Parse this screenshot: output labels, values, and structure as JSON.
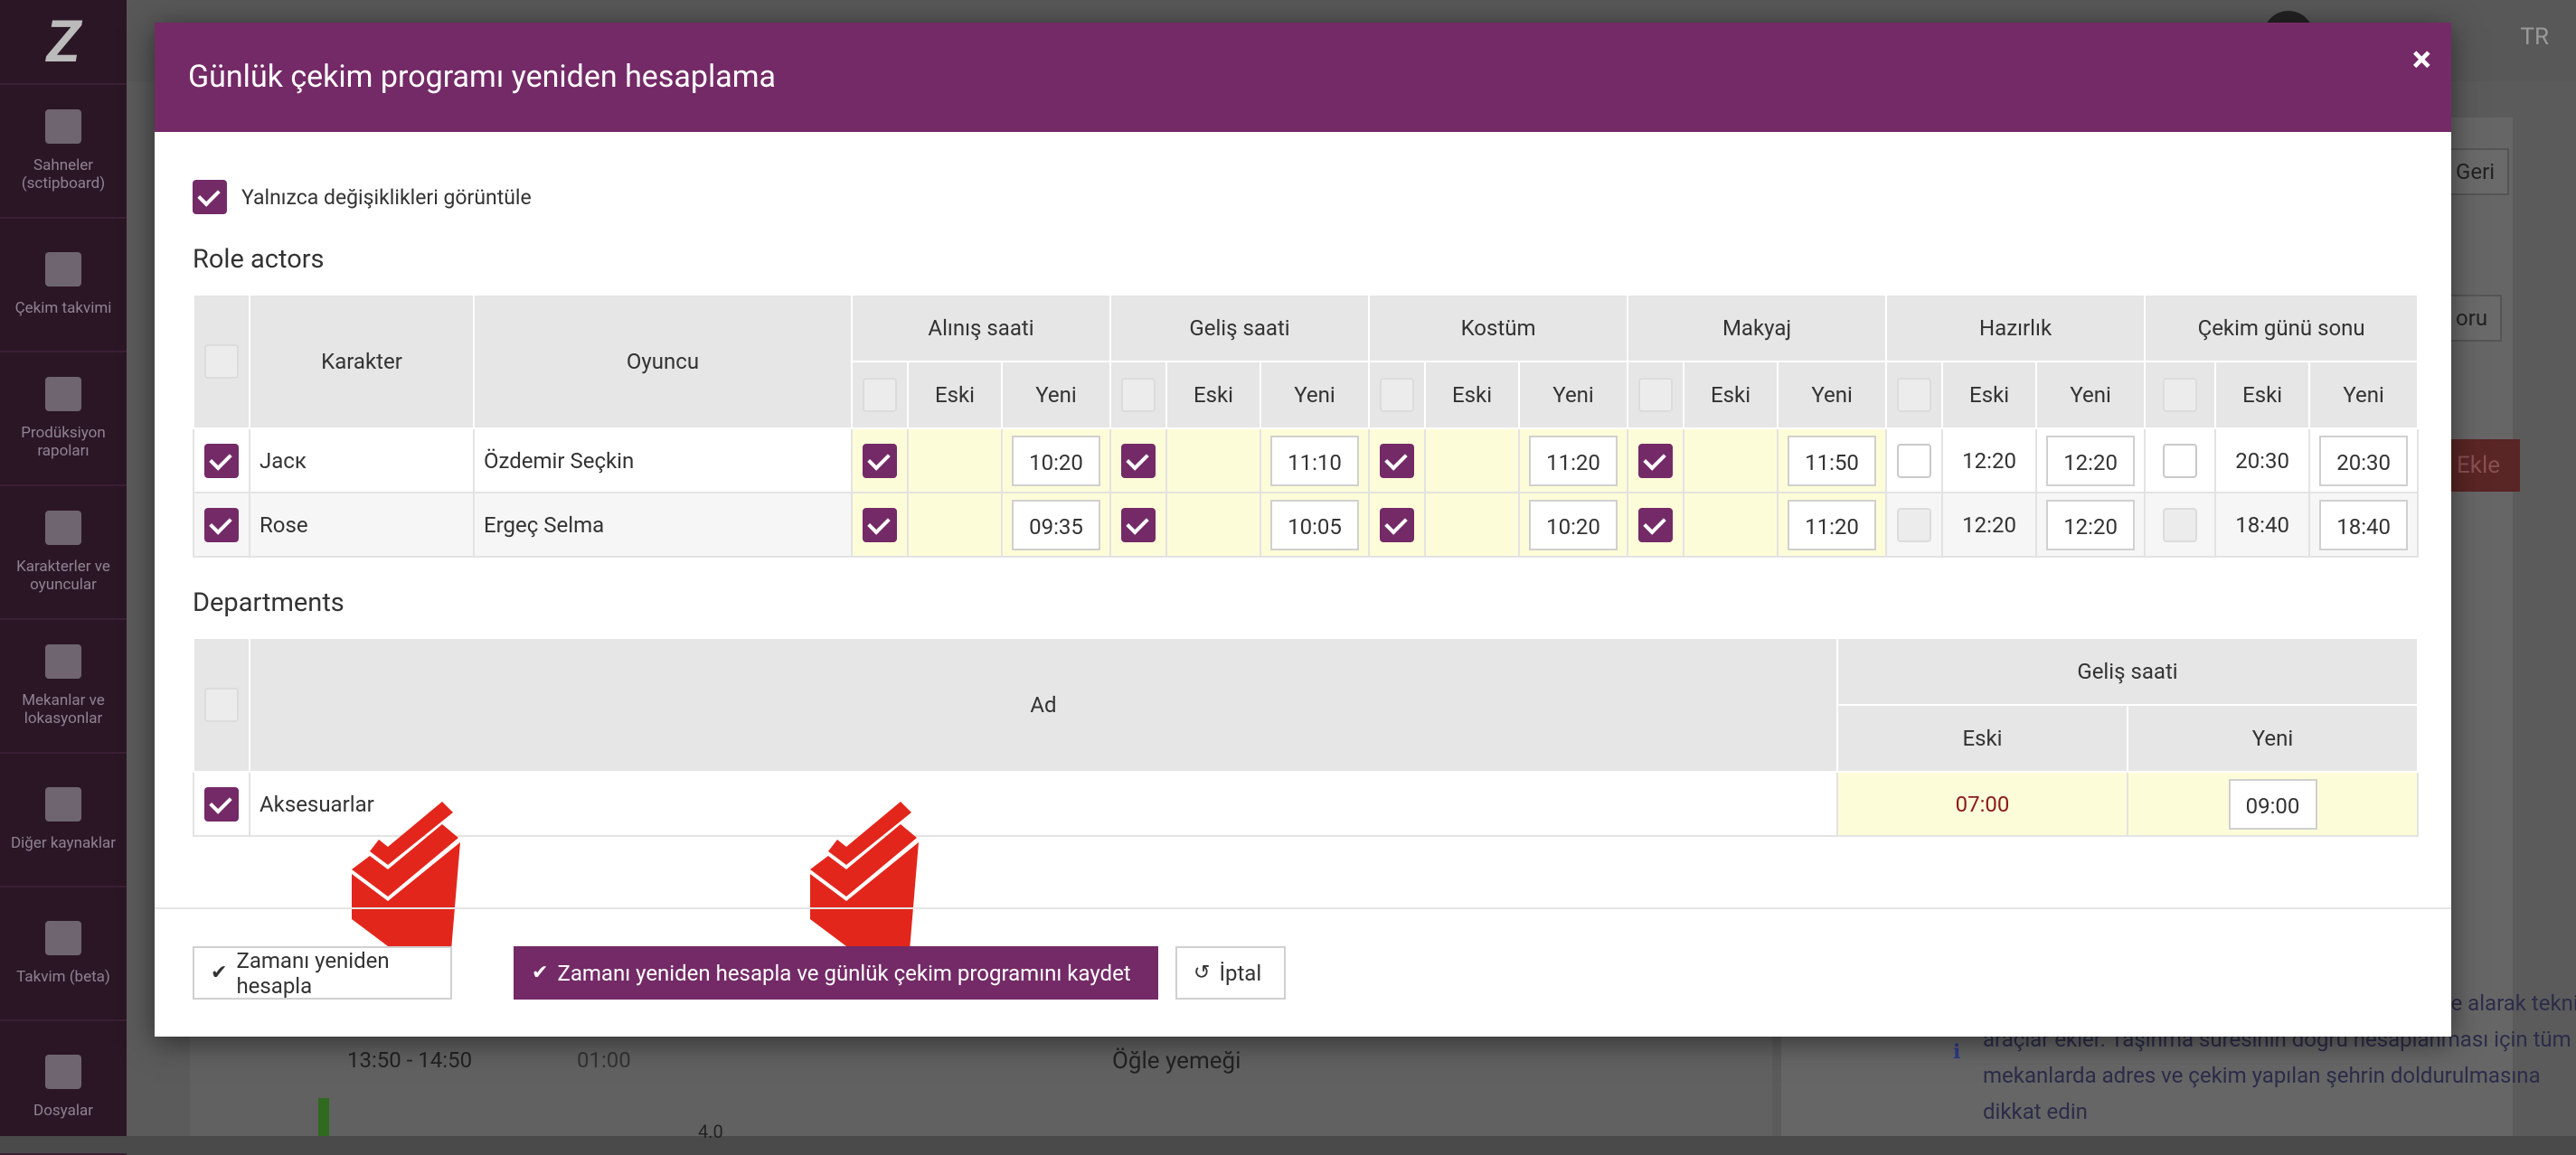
{
  "background": {
    "logo": "Z",
    "sidebar": [
      {
        "label": "Sahneler (sctipboard)",
        "icon": "clapperboard-icon"
      },
      {
        "label": "Çekim takvimi",
        "icon": "calendar-icon"
      },
      {
        "label": "Prodüksiyon rapoları",
        "icon": "checkbox-icon"
      },
      {
        "label": "Karakterler ve oyuncular",
        "icon": "users-icon"
      },
      {
        "label": "Mekanlar ve lokasyonlar",
        "icon": "image-icon"
      },
      {
        "label": "Diğer kaynaklar",
        "icon": "archive-icon"
      },
      {
        "label": "Takvim (beta)",
        "icon": "calendar-beta-icon"
      },
      {
        "label": "Dosyalar",
        "icon": "file-icon"
      }
    ],
    "lang": "TR",
    "back_btn": "Geri",
    "right_btn": "oru",
    "add_btn": "Ekle",
    "row_time": "13:50 - 14:50",
    "row_dur": "01:00",
    "row_label": "Öğle yemeği",
    "row_small": "4.0",
    "info_text": "k olarak hesapla katar ve trafik sıkışıklığını dikkate alarak teknik araçlar ekler. Taşınma süresinin doğru hesaplanması için tüm mekanlarda adres ve çekim yapılan şehrin doldurulmasına dikkat edin"
  },
  "modal": {
    "title": "Günlük çekim programı yeniden hesaplama",
    "close": "×",
    "only_changes": "Yalnızca değişiklikleri görüntüle",
    "roles_title": "Role actors",
    "departments_title": "Departments",
    "role_table": {
      "col_character": "Karakter",
      "col_actor": "Oyuncu",
      "groups": [
        "Alınış saati",
        "Geliş saati",
        "Kostüm",
        "Makyaj",
        "Hazırlık",
        "Çekim günü sonu"
      ],
      "old": "Eski",
      "new": "Yeni",
      "rows": [
        {
          "character": "Jacк",
          "actor": "Özdemir Seçkin",
          "cells": [
            {
              "state": "checked",
              "old": "",
              "new": "10:20"
            },
            {
              "state": "checked",
              "old": "",
              "new": "11:10"
            },
            {
              "state": "checked",
              "old": "",
              "new": "11:20"
            },
            {
              "state": "checked",
              "old": "",
              "new": "11:50"
            },
            {
              "state": "unchecked",
              "old": "12:20",
              "new": "12:20"
            },
            {
              "state": "unchecked",
              "old": "20:30",
              "new": "20:30"
            }
          ]
        },
        {
          "character": "Rose",
          "actor": "Ergeç Selma",
          "cells": [
            {
              "state": "checked",
              "old": "",
              "new": "09:35"
            },
            {
              "state": "checked",
              "old": "",
              "new": "10:05"
            },
            {
              "state": "checked",
              "old": "",
              "new": "10:20"
            },
            {
              "state": "checked",
              "old": "",
              "new": "11:20"
            },
            {
              "state": "disabled",
              "old": "12:20",
              "new": "12:20"
            },
            {
              "state": "disabled",
              "old": "18:40",
              "new": "18:40"
            }
          ]
        }
      ]
    },
    "dept_table": {
      "col_name": "Ad",
      "group": "Geliş saati",
      "old": "Eski",
      "new": "Yeni",
      "rows": [
        {
          "name": "Aksesuarlar",
          "old": "07:00",
          "new": "09:00"
        }
      ]
    },
    "buttons": {
      "recalc": "Zamanı yeniden hesapla",
      "recalc_save": "Zamanı yeniden hesapla ve günlük çekim programını kaydet",
      "cancel": "İptal"
    }
  },
  "colors": {
    "accent": "#742a67",
    "highlight": "#fdfcd8",
    "arrow": "#e3261c"
  }
}
